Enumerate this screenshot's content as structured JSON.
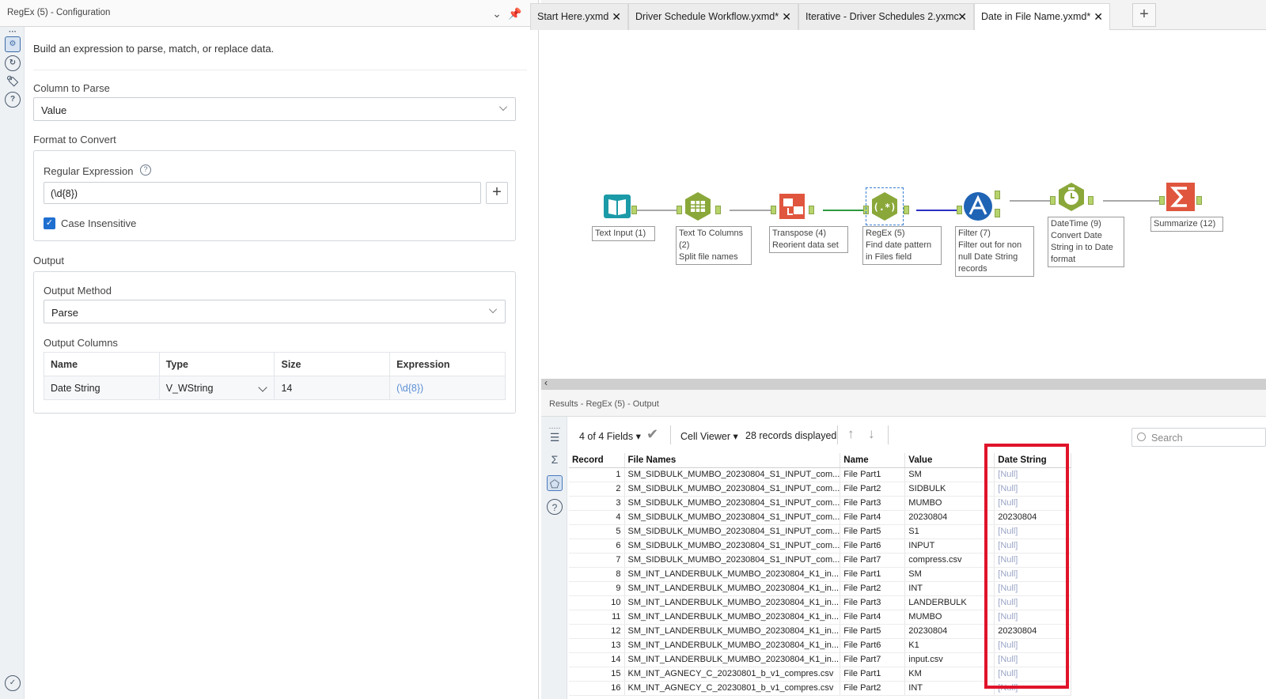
{
  "config_panel": {
    "title": "RegEx (5) - Configuration",
    "description": "Build an expression to parse, match, or replace data.",
    "column_to_parse_label": "Column to Parse",
    "column_to_parse_value": "Value",
    "format_to_convert_label": "Format to Convert",
    "regex_label": "Regular Expression",
    "regex_value": "(\\d{8})",
    "case_insensitive_label": "Case Insensitive",
    "case_insensitive_checked": true,
    "output_label": "Output",
    "output_method_label": "Output Method",
    "output_method_value": "Parse",
    "output_columns_label": "Output Columns",
    "output_columns_headers": [
      "Name",
      "Type",
      "Size",
      "Expression"
    ],
    "output_columns_row": {
      "name": "Date String",
      "type": "V_WString",
      "size": "14",
      "expression": "(\\d{8})"
    }
  },
  "tabs": [
    {
      "label": "Start Here.yxmd",
      "active": false
    },
    {
      "label": "Driver Schedule Workflow.yxmd*",
      "active": false
    },
    {
      "label": "Iterative - Driver Schedules 2.yxmc",
      "active": false
    },
    {
      "label": "Date in File Name.yxmd*",
      "active": true
    }
  ],
  "workflow_tools": [
    {
      "name": "text-input",
      "label_lines": [
        "Text Input (1)"
      ],
      "color": "#1b9aa8"
    },
    {
      "name": "text-to-columns",
      "label_lines": [
        "Text To Columns",
        "(2)",
        "Split file names"
      ],
      "color": "#8aa83a"
    },
    {
      "name": "transpose",
      "label_lines": [
        "Transpose (4)",
        "Reorient data set"
      ],
      "color": "#e0553e"
    },
    {
      "name": "regex",
      "label_lines": [
        "RegEx (5)",
        "Find date pattern",
        "in Files field"
      ],
      "color": "#8aa83a"
    },
    {
      "name": "filter",
      "label_lines": [
        "Filter (7)",
        "Filter out for non",
        "null Date String",
        "records"
      ],
      "color": "#1f63b5"
    },
    {
      "name": "datetime",
      "label_lines": [
        "DateTime (9)",
        "Convert Date",
        "String in to Date",
        "format"
      ],
      "color": "#8aa83a"
    },
    {
      "name": "summarize",
      "label_lines": [
        "Summarize (12)"
      ],
      "color": "#e0553e"
    }
  ],
  "results": {
    "title": "Results - RegEx (5) - Output",
    "fields_label": "4 of 4 Fields",
    "viewer_label": "Cell Viewer",
    "records_label": "28 records displayed",
    "search_placeholder": "Search",
    "columns": [
      "Record",
      "File Names",
      "Name",
      "Value",
      "Date String"
    ],
    "rows": [
      [
        "1",
        "SM_SIDBULK_MUMBO_20230804_S1_INPUT_com...",
        "File Part1",
        "SM",
        "[Null]"
      ],
      [
        "2",
        "SM_SIDBULK_MUMBO_20230804_S1_INPUT_com...",
        "File Part2",
        "SIDBULK",
        "[Null]"
      ],
      [
        "3",
        "SM_SIDBULK_MUMBO_20230804_S1_INPUT_com...",
        "File Part3",
        "MUMBO",
        "[Null]"
      ],
      [
        "4",
        "SM_SIDBULK_MUMBO_20230804_S1_INPUT_com...",
        "File Part4",
        "20230804",
        "20230804"
      ],
      [
        "5",
        "SM_SIDBULK_MUMBO_20230804_S1_INPUT_com...",
        "File Part5",
        "S1",
        "[Null]"
      ],
      [
        "6",
        "SM_SIDBULK_MUMBO_20230804_S1_INPUT_com...",
        "File Part6",
        "INPUT",
        "[Null]"
      ],
      [
        "7",
        "SM_SIDBULK_MUMBO_20230804_S1_INPUT_com...",
        "File Part7",
        "compress.csv",
        "[Null]"
      ],
      [
        "8",
        "SM_INT_LANDERBULK_MUMBO_20230804_K1_in...",
        "File Part1",
        "SM",
        "[Null]"
      ],
      [
        "9",
        "SM_INT_LANDERBULK_MUMBO_20230804_K1_in...",
        "File Part2",
        "INT",
        "[Null]"
      ],
      [
        "10",
        "SM_INT_LANDERBULK_MUMBO_20230804_K1_in...",
        "File Part3",
        "LANDERBULK",
        "[Null]"
      ],
      [
        "11",
        "SM_INT_LANDERBULK_MUMBO_20230804_K1_in...",
        "File Part4",
        "MUMBO",
        "[Null]"
      ],
      [
        "12",
        "SM_INT_LANDERBULK_MUMBO_20230804_K1_in...",
        "File Part5",
        "20230804",
        "20230804"
      ],
      [
        "13",
        "SM_INT_LANDERBULK_MUMBO_20230804_K1_in...",
        "File Part6",
        "K1",
        "[Null]"
      ],
      [
        "14",
        "SM_INT_LANDERBULK_MUMBO_20230804_K1_in...",
        "File Part7",
        "input.csv",
        "[Null]"
      ],
      [
        "15",
        "KM_INT_AGNECY_C_20230801_b_v1_compres.csv",
        "File Part1",
        "KM",
        "[Null]"
      ],
      [
        "16",
        "KM_INT_AGNECY_C_20230801_b_v1_compres.csv",
        "File Part2",
        "INT",
        "[Null]"
      ]
    ]
  },
  "colors": {
    "accent": "#1f6fd0",
    "highlight": "#e0142a",
    "null_text": "#9aa5c6"
  }
}
